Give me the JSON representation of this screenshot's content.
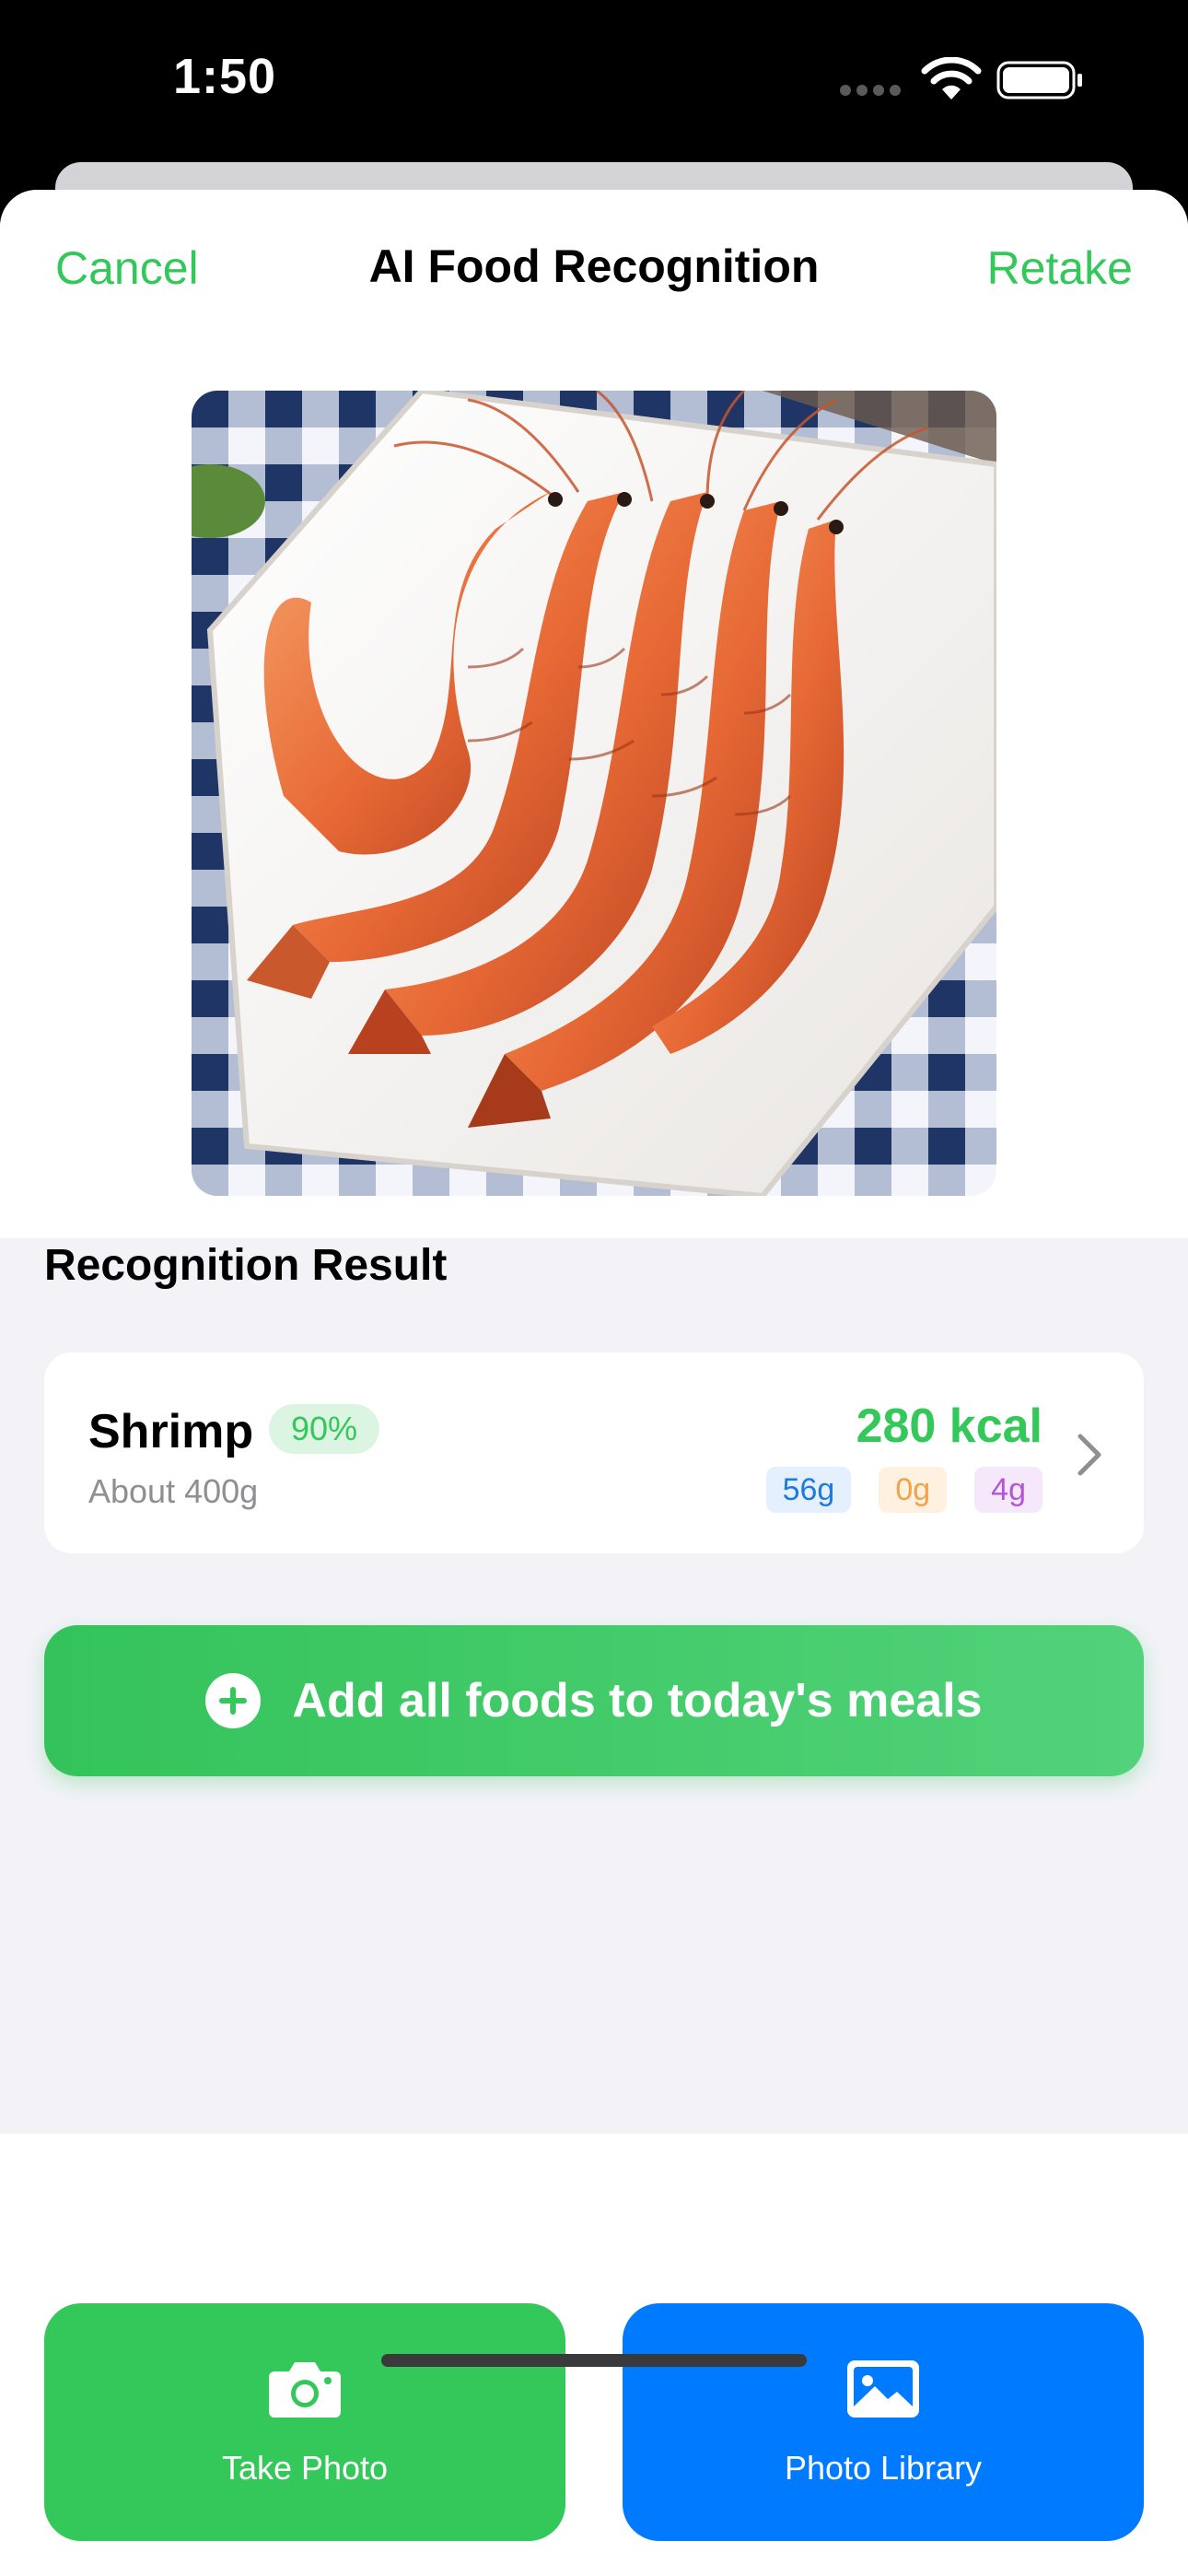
{
  "status_bar": {
    "time": "1:50"
  },
  "nav": {
    "cancel": "Cancel",
    "title": "AI Food Recognition",
    "retake": "Retake"
  },
  "result": {
    "section_title": "Recognition Result",
    "food": {
      "name": "Shrimp",
      "confidence": "90%",
      "portion": "About 400g",
      "calories": "280 kcal",
      "macros": {
        "protein": "56g",
        "fat": "0g",
        "carbs": "4g"
      }
    }
  },
  "add_button": {
    "label": "Add all foods to today's meals"
  },
  "actions": {
    "take_photo": "Take Photo",
    "photo_library": "Photo Library"
  },
  "colors": {
    "accent_green": "#34c759",
    "accent_blue": "#007aff",
    "background": "#f2f2f7"
  },
  "icons": [
    "wifi-icon",
    "battery-icon",
    "chevron-right-icon",
    "plus-circle-icon",
    "camera-icon",
    "photo-icon"
  ]
}
